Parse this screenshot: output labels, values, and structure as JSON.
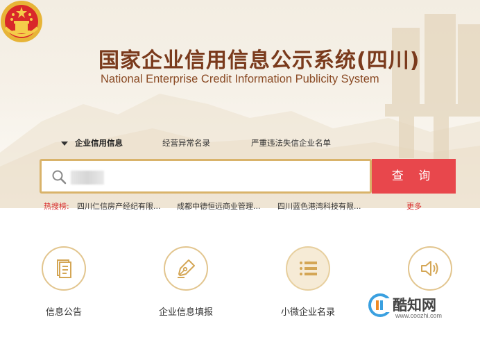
{
  "header": {
    "title_cn": "国家企业信用信息公示系统(四川)",
    "title_en": "National Enterprise Credit Information Publicity System"
  },
  "tabs": [
    {
      "label": "企业信用信息",
      "active": true
    },
    {
      "label": "经营异常名录",
      "active": false
    },
    {
      "label": "严重违法失信企业名单",
      "active": false
    }
  ],
  "search": {
    "button_label": "查 询"
  },
  "hot": {
    "label": "热搜榜:",
    "items": [
      "四川仁信房产经纪有限...",
      "成都中德恒远商业管理...",
      "四川蓝色港湾科技有限..."
    ],
    "more": "更多"
  },
  "features": [
    {
      "label": "信息公告",
      "icon": "document-icon"
    },
    {
      "label": "企业信息填报",
      "icon": "pen-nib-icon"
    },
    {
      "label": "小微企业名录",
      "icon": "list-icon"
    },
    {
      "label": "",
      "icon": "speaker-icon"
    }
  ],
  "watermark": {
    "text": "酷知网",
    "url": "www.coozhi.com"
  },
  "colors": {
    "title": "#7a3a1c",
    "search_border": "#d9b36a",
    "search_button": "#e8474c",
    "hot_label": "#d9302f",
    "icon_gold": "#d4a655"
  }
}
